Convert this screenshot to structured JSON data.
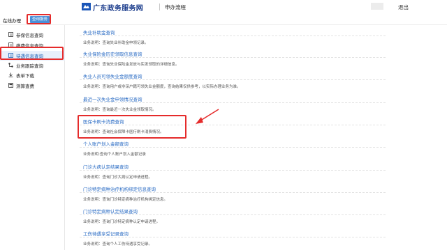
{
  "header": {
    "site_title": "广东政务服务网",
    "process_link": "申办流程",
    "logout": "退出",
    "logo_icon": "gd-gov-logo-icon"
  },
  "subbar": {
    "online_label": "在线办理",
    "query_tab": "查询服务"
  },
  "sidebar": {
    "items": [
      {
        "label": "参保信息查询",
        "icon": "document-icon"
      },
      {
        "label": "缴费信息查询",
        "icon": "document-icon"
      },
      {
        "label": "待遇信息查询",
        "icon": "document-icon",
        "active": true
      },
      {
        "label": "业务跟踪查询",
        "icon": "flow-icon"
      },
      {
        "label": "表单下载",
        "icon": "download-icon"
      },
      {
        "label": "测算查费",
        "icon": "calculator-icon"
      }
    ]
  },
  "main": {
    "entries": [
      {
        "title": "失业补助金查询",
        "desc": "业务说明：查询失业补助金申领记录。"
      },
      {
        "title": "失业保险金历史领取信息查询",
        "desc": "业务说明：查询失业保险金发放与实发领取的详细信息。"
      },
      {
        "title": "失业人员可领失业金额度查询",
        "desc": "业务说明：查询用户或非深户籍可领失业金额度，查询结果仅供参考，以实际办理业务为准。"
      },
      {
        "title": "最近一次失业金申领情况查询",
        "desc": "业务说明：查询最近一次失业金领取情况。"
      },
      {
        "title": "医保卡刷卡消费查询",
        "desc": "业务说明：查询社会保障卡医疗刷卡消费情况。"
      },
      {
        "title": "个人账户划入金额查询",
        "desc": "业务说明:查询个人账户划入金额记录"
      },
      {
        "title": "门诊大病认定结果查询",
        "desc": "业务说明：查询门诊大病认定申请进程。"
      },
      {
        "title": "门诊特定病种治疗机构绑定信息查询",
        "desc": "业务说明：查询门诊特定病种治疗机构绑定信息。"
      },
      {
        "title": "门诊特定病种认定结果查询",
        "desc": "业务说明：查询门诊特定病种认定申请进程。"
      },
      {
        "title": "工伤待遇享受记录查询",
        "desc": "业务说明：查询个人工伤待遇享受记录。"
      }
    ]
  },
  "colors": {
    "brand": "#1b3c8c",
    "link": "#2b6cc4",
    "highlight": "#e52b2b",
    "tab": "#4a90d9"
  }
}
